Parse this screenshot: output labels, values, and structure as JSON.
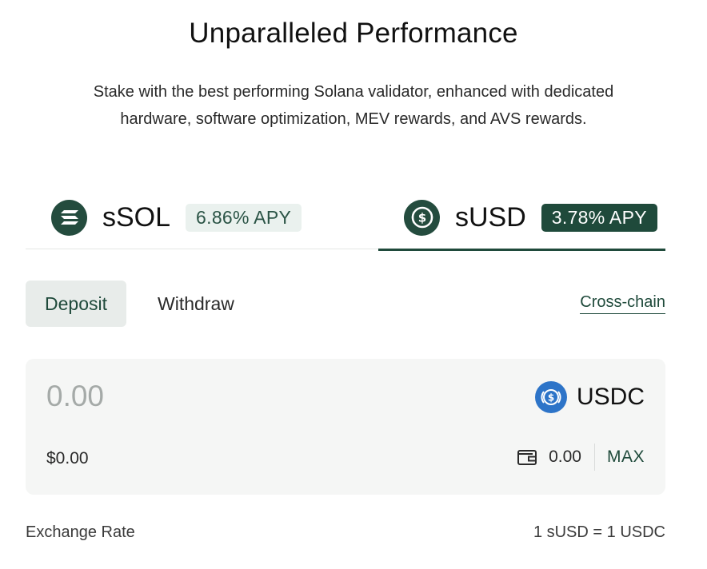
{
  "header": {
    "title": "Unparalleled Performance",
    "subtitle_line1": "Stake with the best performing Solana validator, enhanced with dedicated",
    "subtitle_line2": "hardware, software optimization, MEV rewards, and AVS rewards."
  },
  "tabs": [
    {
      "name": "sSOL",
      "apy": "6.86% APY",
      "icon": "ssol-logo-icon",
      "selected": false
    },
    {
      "name": "sUSD",
      "apy": "3.78% APY",
      "icon": "susd-dollar-icon",
      "selected": true
    }
  ],
  "mode": {
    "deposit_label": "Deposit",
    "withdraw_label": "Withdraw",
    "crosschain_label": "Cross-chain",
    "selected": "Deposit"
  },
  "input": {
    "amount_placeholder": "0.00",
    "usd_value": "$0.00",
    "token": "USDC",
    "token_icon": "usdc-icon",
    "wallet_icon": "wallet-icon",
    "balance": "0.00",
    "max_label": "MAX"
  },
  "exchange": {
    "label": "Exchange Rate",
    "value": "1 sUSD = 1 USDC"
  },
  "colors": {
    "accent": "#1f4a3b",
    "apy_light_bg": "#eaf1ee",
    "usdc_blue": "#2d74c8",
    "card_bg": "#f5f6f5"
  }
}
